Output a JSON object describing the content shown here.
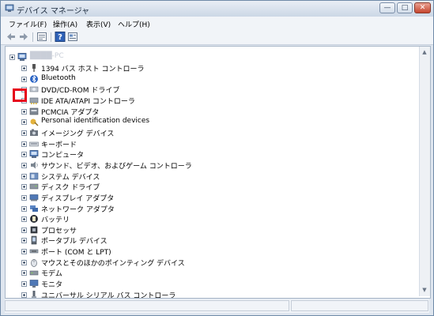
{
  "window": {
    "title": "デバイス マネージャ",
    "caption_buttons": [
      "—",
      "□",
      "✕"
    ]
  },
  "menu": [
    {
      "label": "ファイル(F)"
    },
    {
      "label": "操作(A)"
    },
    {
      "label": "表示(V)"
    },
    {
      "label": "ヘルプ(H)"
    }
  ],
  "toolbar": {
    "icons": [
      "back-arrow-icon",
      "forward-arrow-icon",
      "properties-icon",
      "help-icon",
      "view-icon"
    ]
  },
  "tree": {
    "root": {
      "label": "████-PC"
    },
    "items": [
      {
        "label": "1394 バス ホスト コントローラ",
        "icon": "plug-icon"
      },
      {
        "label": "Bluetooth",
        "icon": "bluetooth-icon"
      },
      {
        "label": "DVD/CD-ROM ドライブ",
        "icon": "disc-drive-icon"
      },
      {
        "label": "IDE ATA/ATAPI コントローラ",
        "icon": "ide-controller-icon"
      },
      {
        "label": "PCMCIA アダプタ",
        "icon": "card-adapter-icon"
      },
      {
        "label": "Personal identification devices",
        "icon": "fingerprint-icon"
      },
      {
        "label": "イメージング デバイス",
        "icon": "camera-icon"
      },
      {
        "label": "キーボード",
        "icon": "keyboard-icon"
      },
      {
        "label": "コンピュータ",
        "icon": "computer-icon"
      },
      {
        "label": "サウンド、ビデオ、およびゲーム コントローラ",
        "icon": "speaker-icon"
      },
      {
        "label": "システム デバイス",
        "icon": "system-device-icon"
      },
      {
        "label": "ディスク ドライブ",
        "icon": "disk-drive-icon"
      },
      {
        "label": "ディスプレイ アダプタ",
        "icon": "display-adapter-icon"
      },
      {
        "label": "ネットワーク アダプタ",
        "icon": "network-adapter-icon"
      },
      {
        "label": "バッテリ",
        "icon": "battery-icon"
      },
      {
        "label": "プロセッサ",
        "icon": "processor-icon"
      },
      {
        "label": "ポータブル デバイス",
        "icon": "portable-device-icon"
      },
      {
        "label": "ポート (COM と LPT)",
        "icon": "port-icon"
      },
      {
        "label": "マウスとそのほかのポインティング デバイス",
        "icon": "mouse-icon"
      },
      {
        "label": "モデム",
        "icon": "modem-icon"
      },
      {
        "label": "モニタ",
        "icon": "monitor-icon"
      },
      {
        "label": "ユニバーサル シリアル バス コントローラ",
        "icon": "usb-icon"
      }
    ]
  },
  "highlight": {
    "target": "IDE ATA/ATAPI コントローラ",
    "color": "#e6001a"
  }
}
